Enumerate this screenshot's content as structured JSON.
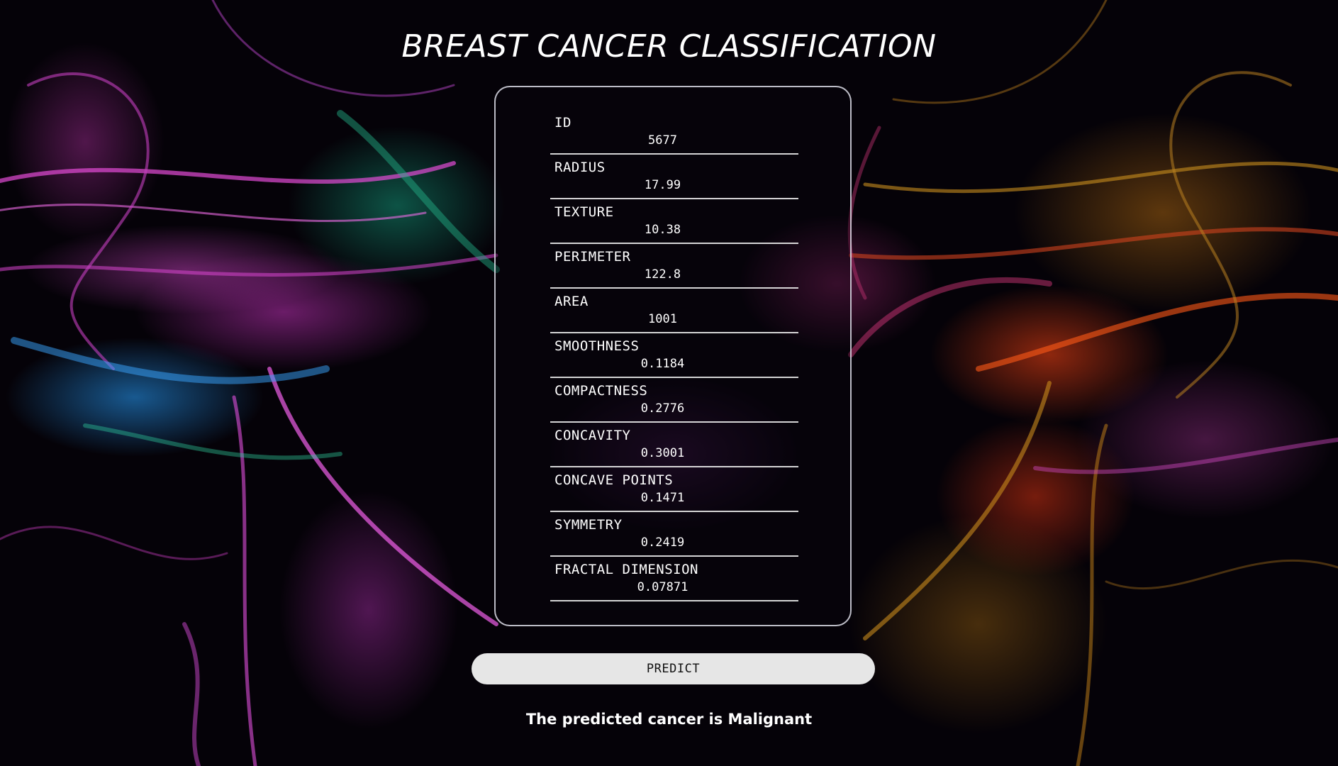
{
  "page": {
    "title": "BREAST CANCER CLASSIFICATION"
  },
  "form": {
    "fields": [
      {
        "label": "ID",
        "value": "5677"
      },
      {
        "label": "RADIUS",
        "value": "17.99"
      },
      {
        "label": "TEXTURE",
        "value": "10.38"
      },
      {
        "label": "PERIMETER",
        "value": "122.8"
      },
      {
        "label": "AREA",
        "value": "1001"
      },
      {
        "label": "SMOOTHNESS",
        "value": "0.1184"
      },
      {
        "label": "COMPACTNESS",
        "value": "0.2776"
      },
      {
        "label": "CONCAVITY",
        "value": "0.3001"
      },
      {
        "label": "CONCAVE POINTS",
        "value": "0.1471"
      },
      {
        "label": "SYMMETRY",
        "value": "0.2419"
      },
      {
        "label": "FRACTAL DIMENSION",
        "value": "0.07871"
      }
    ]
  },
  "actions": {
    "predict_label": "PREDICT"
  },
  "result": {
    "text": "The predicted cancer is Malignant"
  },
  "colors": {
    "background": "#050208",
    "text": "#ffffff",
    "button_bg": "#e6e6e6",
    "button_text": "#111111",
    "card_border": "#ebebf5"
  }
}
